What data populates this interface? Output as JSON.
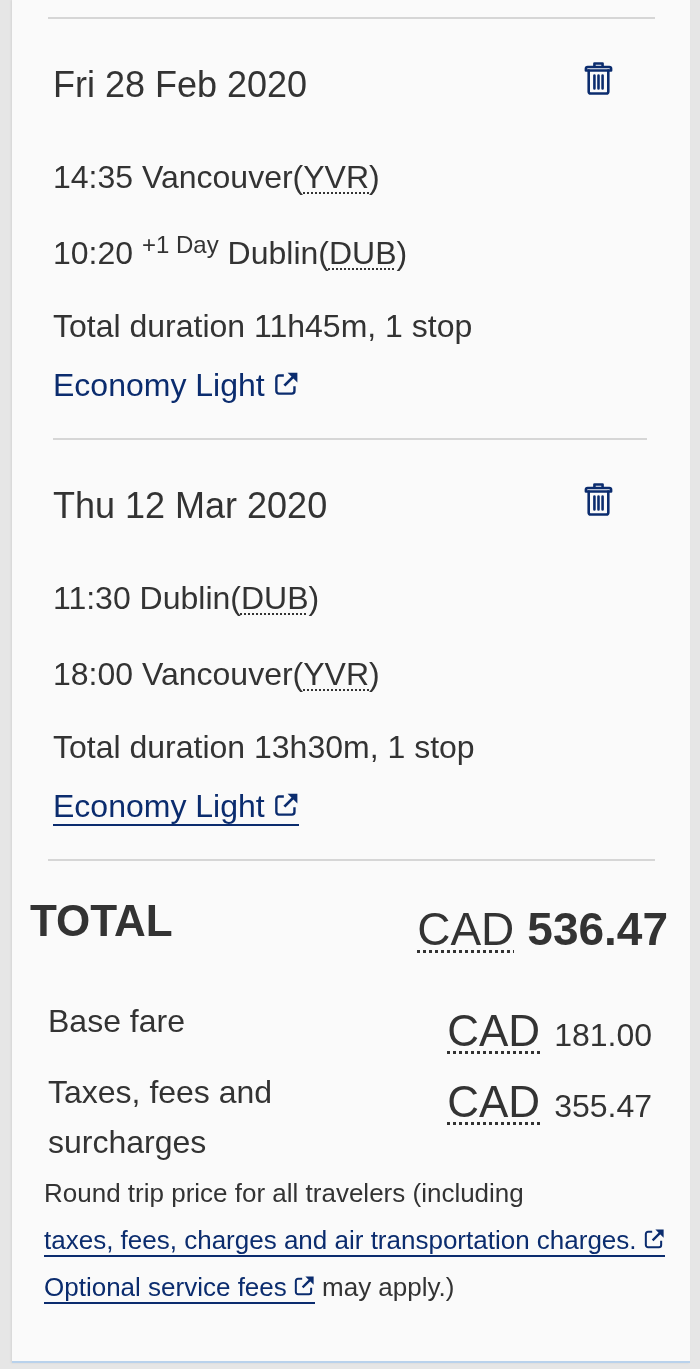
{
  "flights": [
    {
      "date": "Fri 28 Feb 2020",
      "departure": {
        "text": "14:35 Vancouver(",
        "code": "YVR",
        "tail": ")"
      },
      "arrival": {
        "text": "10:20 $^{+1 Day}$ Dublin(",
        "code": "DUB",
        "tail": ")"
      },
      "duration": "Total duration 11h45m, 1 stop",
      "fare": {
        "label": "Economy Light",
        "hovered": false
      }
    },
    {
      "date": "Thu 12 Mar 2020",
      "departure": {
        "text": "11:30 Dublin(",
        "code": "DUB",
        "tail": ")"
      },
      "arrival": {
        "text": "18:00 Vancouver(",
        "code": "YVR",
        "tail": ")"
      },
      "duration": "Total duration 13h30m, 1 stop",
      "fare": {
        "label": "Economy Light",
        "hovered": true
      }
    }
  ],
  "total": {
    "label": "TOTAL",
    "currency": "CAD",
    "amount": "536.47"
  },
  "breakdown": [
    {
      "label": "Base fare",
      "currency": "CAD",
      "amount": "181.00"
    },
    {
      "label": "Taxes, fees and surcharges",
      "currency": "CAD",
      "amount": "355.47"
    }
  ],
  "note": {
    "text": "Round trip price for all travelers (including",
    "links": [
      "taxes, fees, charges and air transportation charges.",
      "Optional service fees"
    ],
    "tail": "may apply.)"
  }
}
